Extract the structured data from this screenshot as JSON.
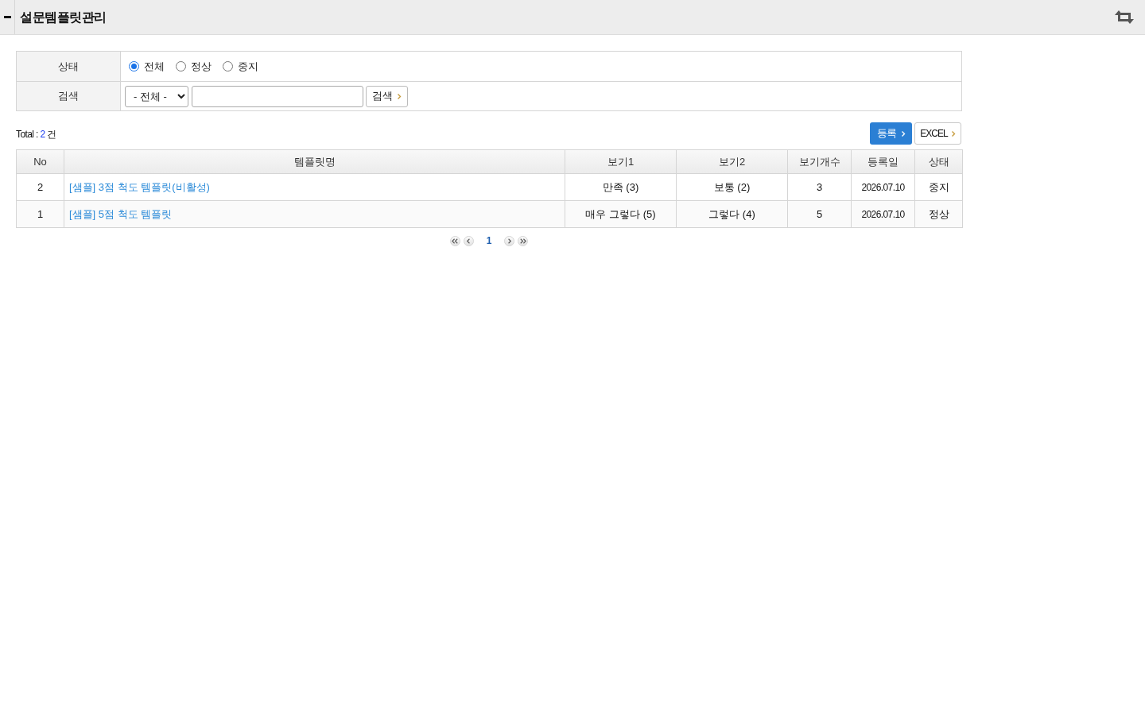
{
  "header": {
    "title": "설문템플릿관리"
  },
  "status_filter": {
    "label": "상태",
    "options": [
      {
        "label": "전체",
        "selected": true
      },
      {
        "label": "정상",
        "selected": false
      },
      {
        "label": "중지",
        "selected": false
      }
    ]
  },
  "search_filter": {
    "label": "검색",
    "select_value": "- 전체 -",
    "button": "검색"
  },
  "summary": {
    "label": "Total :",
    "count": "2",
    "unit": "건"
  },
  "actions": [
    {
      "label": "등록",
      "kind": "primary"
    },
    {
      "label": "EXCEL",
      "kind": "secondary"
    }
  ],
  "table": {
    "columns": [
      "No",
      "템플릿명",
      "보기1",
      "보기2",
      "보기개수",
      "등록일",
      "상태"
    ],
    "rows": [
      {
        "no": "2",
        "name": "[샘플] 3점 척도 템플릿(비활성)",
        "option_1": "만족 (3)",
        "option_2": "보통 (2)",
        "option_count": "3",
        "created": "2026.07.10",
        "status": "중지"
      },
      {
        "no": "1",
        "name": "[샘플] 5점 척도 템플릿",
        "option_1": "매우 그렇다 (5)",
        "option_2": "그렇다 (4)",
        "option_count": "5",
        "created": "2026.07.10",
        "status": "정상"
      }
    ]
  },
  "pagination": {
    "pages": [
      {
        "label": "1",
        "selected": true
      }
    ]
  }
}
